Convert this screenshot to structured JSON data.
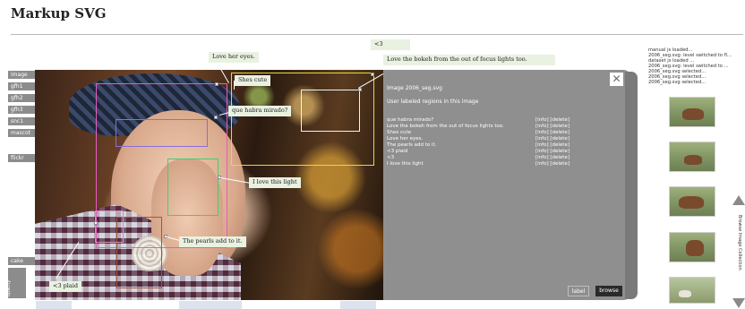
{
  "title": "Markup SVG",
  "side_tabs": [
    "image",
    "gfh1",
    "gfh2",
    "gfh3",
    "snc1",
    "mascot",
    "flickr"
  ],
  "bottom_tabs": [
    "cake",
    "opacity"
  ],
  "photo_tip": "<3",
  "notes": {
    "love_eyes": "Love her eyes.",
    "shes_cute": "Shes cute",
    "que_habra": "que habra mirado?",
    "bokeh": "Love the bokeh from the out of focus lights too.",
    "this_light": "I love this light",
    "pearls": "The pearls add to it.",
    "plaid": "<3 plaid"
  },
  "panel": {
    "heading": "Image 2006_seg.svg",
    "subheading": "User labeled regions in this image",
    "close": "✕",
    "rows": [
      {
        "text": "que habra mirado?",
        "actions": "[info] [delete]"
      },
      {
        "text": "Love the bokeh from the out of focus lights too.",
        "actions": "[info] [delete]"
      },
      {
        "text": "Shes cute",
        "actions": "[info] [delete]"
      },
      {
        "text": "Love her eyes.",
        "actions": "[info] [delete]"
      },
      {
        "text": "The pearls add to it.",
        "actions": "[info] [delete]"
      },
      {
        "text": "<3 plaid",
        "actions": "[info] [delete]"
      },
      {
        "text": "<3",
        "actions": "[info] [delete]"
      },
      {
        "text": "I love this light",
        "actions": "[info] [delete]"
      }
    ],
    "label_btn": "label",
    "browse_btn": "browse"
  },
  "log": [
    "manual js loaded...",
    "2006_seg.svg: level switched to fl...",
    "dataset js loaded ...",
    "2006_seg.svg: level switched to ...",
    "2006_seg.svg selected...",
    "2006_seg.svg selected...",
    "2006_seg.svg selected..."
  ],
  "collection_label": "Browse Image Collection",
  "icons": {
    "up": "triangle-up",
    "down": "triangle-down",
    "close": "close-x"
  },
  "colors": {
    "panel": "#8f8f8f",
    "region_pink": "#e85cc0",
    "region_purple": "#8a6fd8",
    "region_green": "#3fd06a",
    "region_yellow": "#e2dc3a",
    "region_white": "#f2f2f2",
    "region_brown": "#a05a3a",
    "note_bg": "#e9f1e0"
  }
}
